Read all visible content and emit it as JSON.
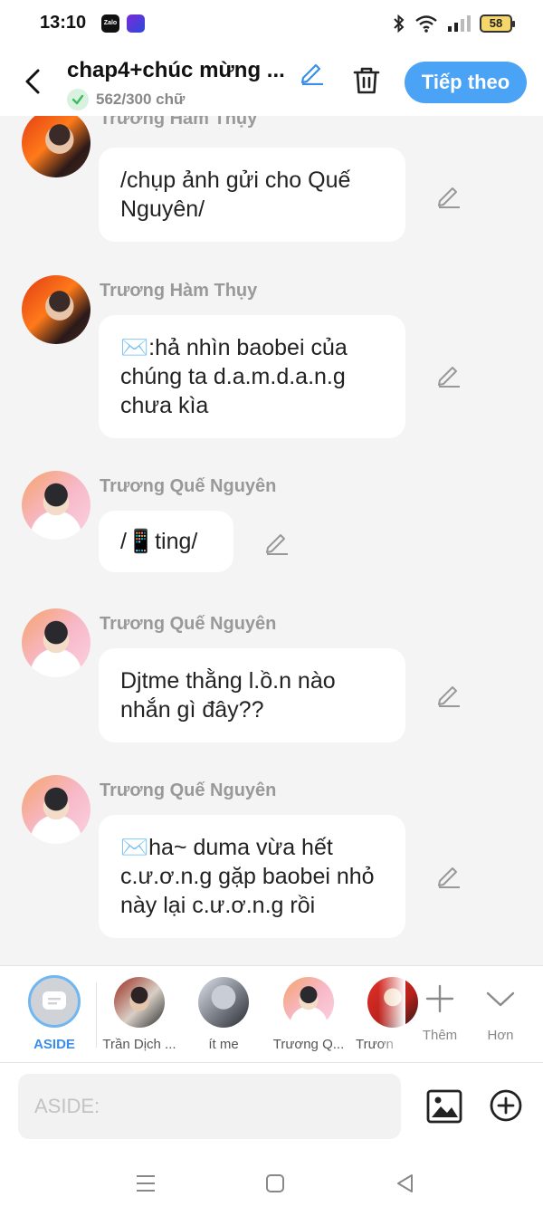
{
  "status_bar": {
    "time": "13:10",
    "app_icon_1": "Zalo",
    "battery": "58",
    "icons": [
      "bluetooth-icon",
      "wifi-icon",
      "signal-icon",
      "battery-icon"
    ]
  },
  "header": {
    "title": "chap4+chúc mừng ...",
    "word_count": "562/300 chữ",
    "next_button": "Tiếp theo",
    "accent_color": "#4aa3f5"
  },
  "messages": [
    {
      "sender": "Trương Hàm Thụy",
      "avatar": "dark",
      "text": "/chụp ảnh gửi cho Quế Nguyên/"
    },
    {
      "sender": "Trương Hàm Thụy",
      "avatar": "dark",
      "text": "✉️:hả nhìn baobei của chúng ta d.a.m.d.a.n.g chưa kìa"
    },
    {
      "sender": "Trương Quế Nguyên",
      "avatar": "light",
      "text": "/📱ting/"
    },
    {
      "sender": "Trương Quế Nguyên",
      "avatar": "light",
      "text": "Djtme thằng l.ồ.n nào nhắn gì đây??"
    },
    {
      "sender": "Trương Quế Nguyên",
      "avatar": "light",
      "text": "✉️ha~ duma vừa hết c.ư.ơ.n.g gặp baobei nhỏ này lại c.ư.ơ.n.g rồi"
    }
  ],
  "character_bar": {
    "aside_label": "ASIDE",
    "characters": [
      {
        "name": "Trần Dịch ..."
      },
      {
        "name": "ít me"
      },
      {
        "name": "Trương Q..."
      },
      {
        "name": "Trươn"
      }
    ],
    "add_label": "Thêm",
    "more_label": "Hơn"
  },
  "input": {
    "placeholder": "ASIDE:"
  }
}
